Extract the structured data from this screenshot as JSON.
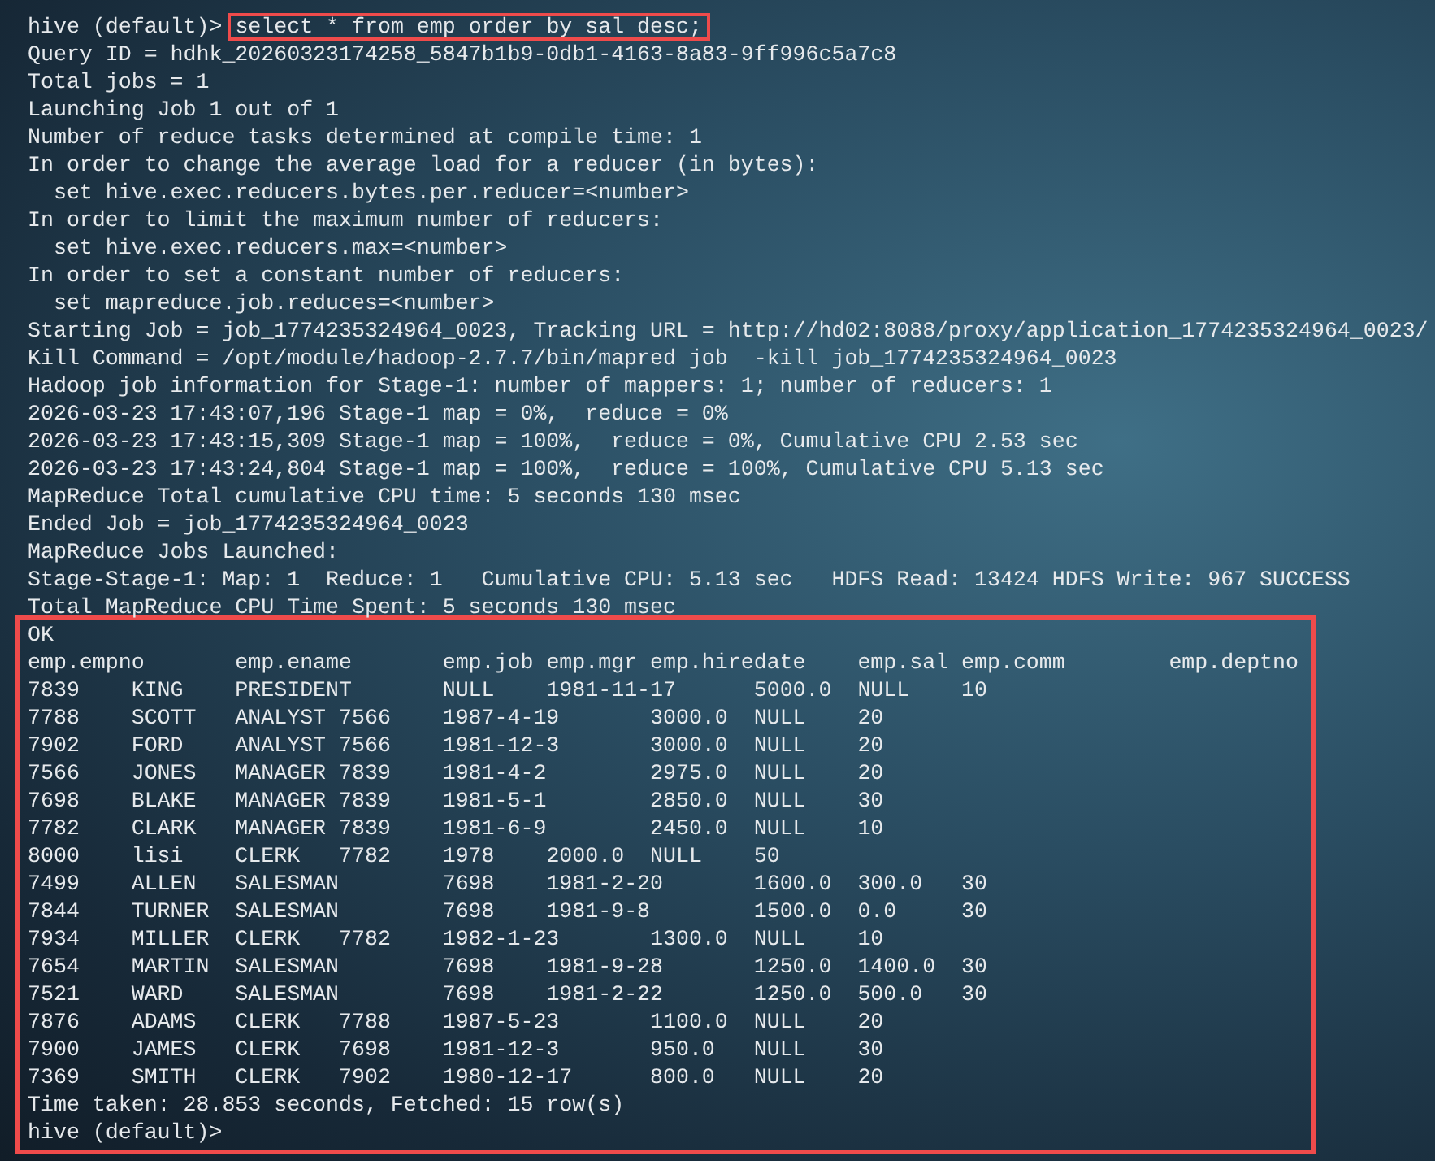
{
  "terminal": {
    "prompt": "hive (default)>",
    "command": "select * from emp order by sal desc;",
    "command_highlighted": true,
    "log_lines": [
      "Query ID = hdhk_20260323174258_5847b1b9-0db1-4163-8a83-9ff996c5a7c8",
      "Total jobs = 1",
      "Launching Job 1 out of 1",
      "Number of reduce tasks determined at compile time: 1",
      "In order to change the average load for a reducer (in bytes):",
      "  set hive.exec.reducers.bytes.per.reducer=<number>",
      "In order to limit the maximum number of reducers:",
      "  set hive.exec.reducers.max=<number>",
      "In order to set a constant number of reducers:",
      "  set mapreduce.job.reduces=<number>",
      "Starting Job = job_1774235324964_0023, Tracking URL = http://hd02:8088/proxy/application_1774235324964_0023/",
      "Kill Command = /opt/module/hadoop-2.7.7/bin/mapred job  -kill job_1774235324964_0023",
      "Hadoop job information for Stage-1: number of mappers: 1; number of reducers: 1",
      "2026-03-23 17:43:07,196 Stage-1 map = 0%,  reduce = 0%",
      "2026-03-23 17:43:15,309 Stage-1 map = 100%,  reduce = 0%, Cumulative CPU 2.53 sec",
      "2026-03-23 17:43:24,804 Stage-1 map = 100%,  reduce = 100%, Cumulative CPU 5.13 sec",
      "MapReduce Total cumulative CPU time: 5 seconds 130 msec",
      "Ended Job = job_1774235324964_0023",
      "MapReduce Jobs Launched:",
      "Stage-Stage-1: Map: 1  Reduce: 1   Cumulative CPU: 5.13 sec   HDFS Read: 13424 HDFS Write: 967 SUCCESS",
      "Total MapReduce CPU Time Spent: 5 seconds 130 msec"
    ],
    "result": {
      "highlighted": true,
      "status": "OK",
      "header_line": "emp.empno\temp.ename\temp.job\temp.mgr\temp.hiredate\temp.sal\temp.comm\temp.deptno",
      "output_lines": [
        "7839\tKING\tPRESIDENT\tNULL\t1981-11-17\t5000.0\tNULL\t10",
        "7788\tSCOTT\tANALYST\t7566\t1987-4-19\t3000.0\tNULL\t20",
        "7902\tFORD\tANALYST\t7566\t1981-12-3\t3000.0\tNULL\t20",
        "7566\tJONES\tMANAGER\t7839\t1981-4-2\t2975.0\tNULL\t20",
        "7698\tBLAKE\tMANAGER\t7839\t1981-5-1\t2850.0\tNULL\t30",
        "7782\tCLARK\tMANAGER\t7839\t1981-6-9\t2450.0\tNULL\t10",
        "8000\tlisi\tCLERK\t7782\t1978\t2000.0\tNULL\t50",
        "7499\tALLEN\tSALESMAN\t7698\t1981-2-20\t1600.0\t300.0\t30",
        "7844\tTURNER\tSALESMAN\t7698\t1981-9-8\t1500.0\t0.0\t30",
        "7934\tMILLER\tCLERK\t7782\t1982-1-23\t1300.0\tNULL\t10",
        "7654\tMARTIN\tSALESMAN\t7698\t1981-9-28\t1250.0\t1400.0\t30",
        "7521\tWARD\tSALESMAN\t7698\t1981-2-22\t1250.0\t500.0\t30",
        "7876\tADAMS\tCLERK\t7788\t1987-5-23\t1100.0\tNULL\t20",
        "7900\tJAMES\tCLERK\t7698\t1981-12-3\t950.0\tNULL\t30",
        "7369\tSMITH\tCLERK\t7902\t1980-12-17\t800.0\tNULL\t20"
      ],
      "summary": "Time taken: 28.853 seconds, Fetched: 15 row(s)",
      "prompt": "hive (default)>"
    }
  }
}
